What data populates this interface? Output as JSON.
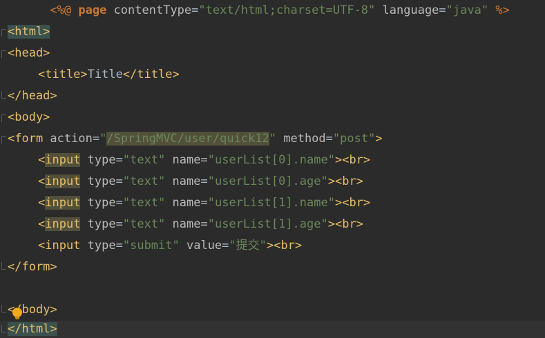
{
  "editor": {
    "language": "jsp",
    "lines": [
      {
        "open": "<%@",
        "directive": " page ",
        "attr1": "contentType",
        "eq1": "=",
        "val1": "\"text/html;charset=UTF-8\"",
        "sp": " ",
        "attr2": "language",
        "eq2": "=",
        "val2": "\"java\"",
        "close": " %>"
      },
      {
        "tag": "<html>"
      },
      {
        "tag": "<head>"
      },
      {
        "open": "<title>",
        "text": "Title",
        "close": "</title>"
      },
      {
        "tag": "</head>"
      },
      {
        "tag": "<body>"
      },
      {
        "open": "<form",
        "attr1": " action",
        "eq1": "=",
        "q1": "\"",
        "val1": "/SpringMVC/user/quick12",
        "q2": "\"",
        "attr2": " method",
        "eq2": "=",
        "val2": "\"post\"",
        "close": ">"
      },
      {
        "lt": "<",
        "name": "input",
        "attr1": " type",
        "eq1": "=",
        "val1": "\"text\"",
        "attr2": " name",
        "eq2": "=",
        "val2": "\"userList[0].name\"",
        "close": "><br>"
      },
      {
        "lt": "<",
        "name": "input",
        "attr1": " type",
        "eq1": "=",
        "val1": "\"text\"",
        "attr2": " name",
        "eq2": "=",
        "val2": "\"userList[0].age\"",
        "close": "><br>"
      },
      {
        "lt": "<",
        "name": "input",
        "attr1": " type",
        "eq1": "=",
        "val1": "\"text\"",
        "attr2": " name",
        "eq2": "=",
        "val2": "\"userList[1].name\"",
        "close": "><br>"
      },
      {
        "lt": "<",
        "name": "input",
        "attr1": " type",
        "eq1": "=",
        "val1": "\"text\"",
        "attr2": " name",
        "eq2": "=",
        "val2": "\"userList[1].age\"",
        "close": "><br>"
      },
      {
        "open": "<input",
        "attr1": " type",
        "eq1": "=",
        "val1": "\"submit\"",
        "attr2": " value",
        "eq2": "=",
        "val2": "\"提交\"",
        "close": "><br>"
      },
      {
        "tag": "</form>"
      },
      {
        "tag": ""
      },
      {
        "lt": "<",
        "rest": "/body>"
      },
      {
        "tag": "</html>"
      }
    ]
  },
  "colors": {
    "background": "#2b2b2b",
    "tag": "#e8bf6a",
    "string": "#6a8759",
    "attribute": "#bababa",
    "keyword": "#cc7832",
    "tag_highlight": "#3b514d",
    "occurrence_highlight": "#52503a"
  },
  "icons": {
    "intention": "lightbulb-icon"
  }
}
